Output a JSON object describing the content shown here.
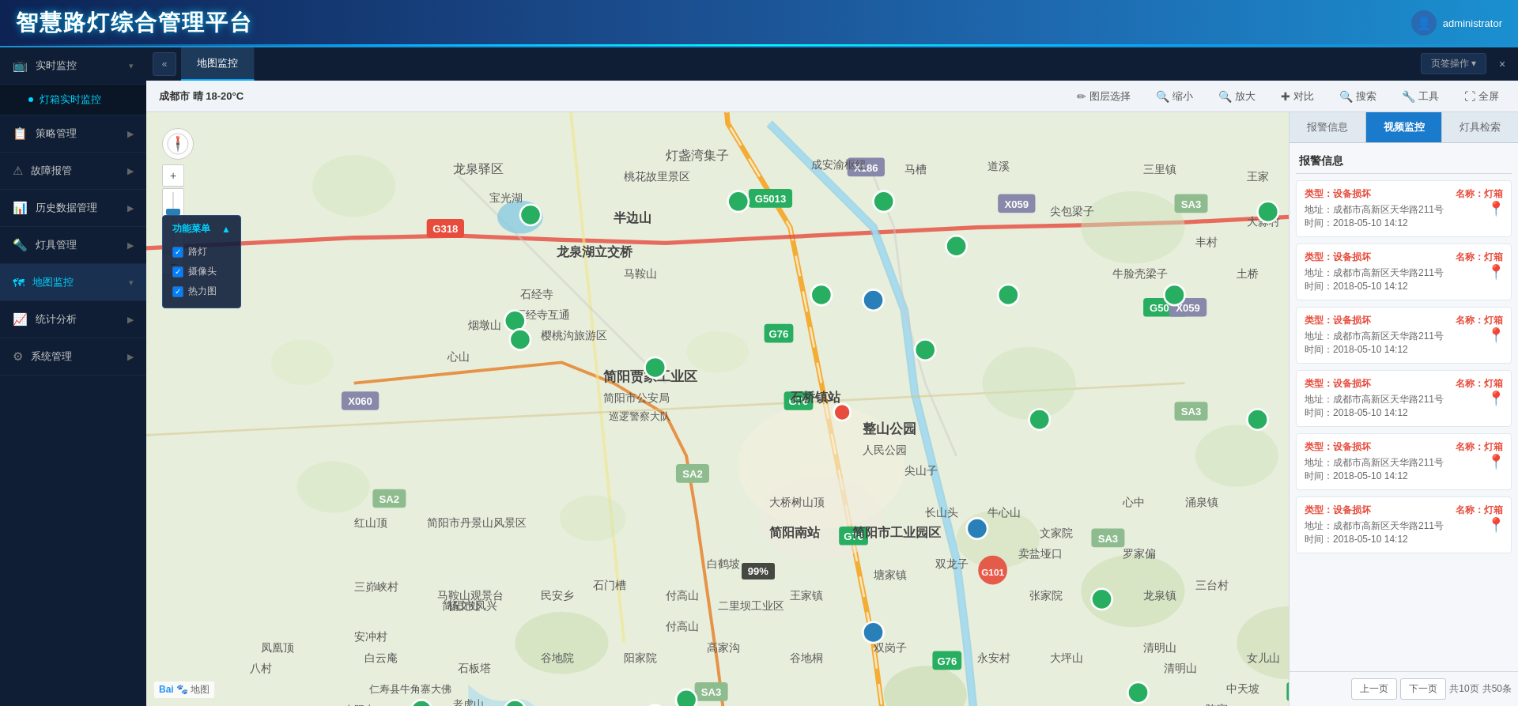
{
  "app": {
    "title": "智慧路灯综合管理平台",
    "user": "administrator"
  },
  "sidebar": {
    "collapse_icon": "«",
    "items": [
      {
        "id": "realtime",
        "label": "实时监控",
        "icon": "📺",
        "active": false,
        "has_sub": true
      },
      {
        "id": "lightbox",
        "label": "灯箱实时监控",
        "icon": "💡",
        "active": false,
        "is_sub": true
      },
      {
        "id": "strategy",
        "label": "策略管理",
        "icon": "📋",
        "active": false,
        "has_sub": true
      },
      {
        "id": "fault",
        "label": "故障报管",
        "icon": "⚠",
        "active": false,
        "has_sub": true
      },
      {
        "id": "history",
        "label": "历史数据管理",
        "icon": "📊",
        "active": false,
        "has_sub": true
      },
      {
        "id": "lamp",
        "label": "灯具管理",
        "icon": "🔦",
        "active": false,
        "has_sub": true
      },
      {
        "id": "map",
        "label": "地图监控",
        "icon": "🗺",
        "active": true,
        "has_sub": true
      },
      {
        "id": "stats",
        "label": "统计分析",
        "icon": "📈",
        "active": false,
        "has_sub": true
      },
      {
        "id": "system",
        "label": "系统管理",
        "icon": "⚙",
        "active": false,
        "has_sub": true
      }
    ]
  },
  "tabs": {
    "active": "map_monitor",
    "items": [
      {
        "id": "map_monitor",
        "label": "地图监控"
      }
    ],
    "action_label": "页签操作 ▾",
    "close_label": "×"
  },
  "map": {
    "weather": "成都市 晴 18-20°C",
    "toolbar": {
      "layer": "图层选择",
      "zoom_out": "缩小",
      "zoom_in": "放大",
      "compare": "对比",
      "search": "搜索",
      "tool": "工具",
      "fullscreen": "全屏"
    },
    "function_panel": {
      "title": "功能菜单",
      "items": [
        {
          "id": "street_light",
          "label": "路灯",
          "checked": true
        },
        {
          "id": "camera",
          "label": "摄像头",
          "checked": true
        },
        {
          "id": "heatmap",
          "label": "热力图",
          "checked": true
        }
      ]
    },
    "percent": "99%",
    "baidu_logo": "Bai 地图"
  },
  "right_panel": {
    "tabs": [
      {
        "id": "alarm",
        "label": "报警信息",
        "active": false
      },
      {
        "id": "video",
        "label": "视频监控",
        "active": true
      },
      {
        "id": "lamp_check",
        "label": "灯具检索",
        "active": false
      }
    ],
    "alarm_header": "报警信息",
    "alarms": [
      {
        "type": "类型：设备损坏",
        "name_label": "名称：",
        "name": "灯箱",
        "addr_label": "地址：成都市高新区天华路211号",
        "time_label": "时间：2018-05-10 14:12"
      },
      {
        "type": "类型：设备损坏",
        "name_label": "名称：",
        "name": "灯箱",
        "addr_label": "地址：成都市高新区天华路211号",
        "time_label": "时间：2018-05-10 14:12"
      },
      {
        "type": "类型：设备损坏",
        "name_label": "名称：",
        "name": "灯箱",
        "addr_label": "地址：成都市高新区天华路211号",
        "time_label": "时间：2018-05-10 14:12"
      },
      {
        "type": "类型：设备损坏",
        "name_label": "名称：",
        "name": "灯箱",
        "addr_label": "地址：成都市高新区天华路211号",
        "time_label": "时间：2018-05-10 14:12"
      },
      {
        "type": "类型：设备损坏",
        "name_label": "名称：",
        "name": "灯箱",
        "addr_label": "地址：成都市高新区天华路211号",
        "time_label": "时间：2018-05-10 14:12"
      },
      {
        "type": "类型：设备损坏",
        "name_label": "名称：",
        "name": "灯箱",
        "addr_label": "地址：成都市高新区天华路211号",
        "time_label": "时间：2018-05-10 14:12"
      }
    ],
    "pagination": {
      "prev": "上一页",
      "next": "下一页",
      "total_pages": "共10页",
      "total_items": "共50条"
    }
  },
  "colors": {
    "header_bg": "#0d2354",
    "sidebar_bg": "#0f1e35",
    "active_blue": "#00d4ff",
    "alarm_red": "#e74c3c",
    "tab_active": "#1a7acc"
  }
}
